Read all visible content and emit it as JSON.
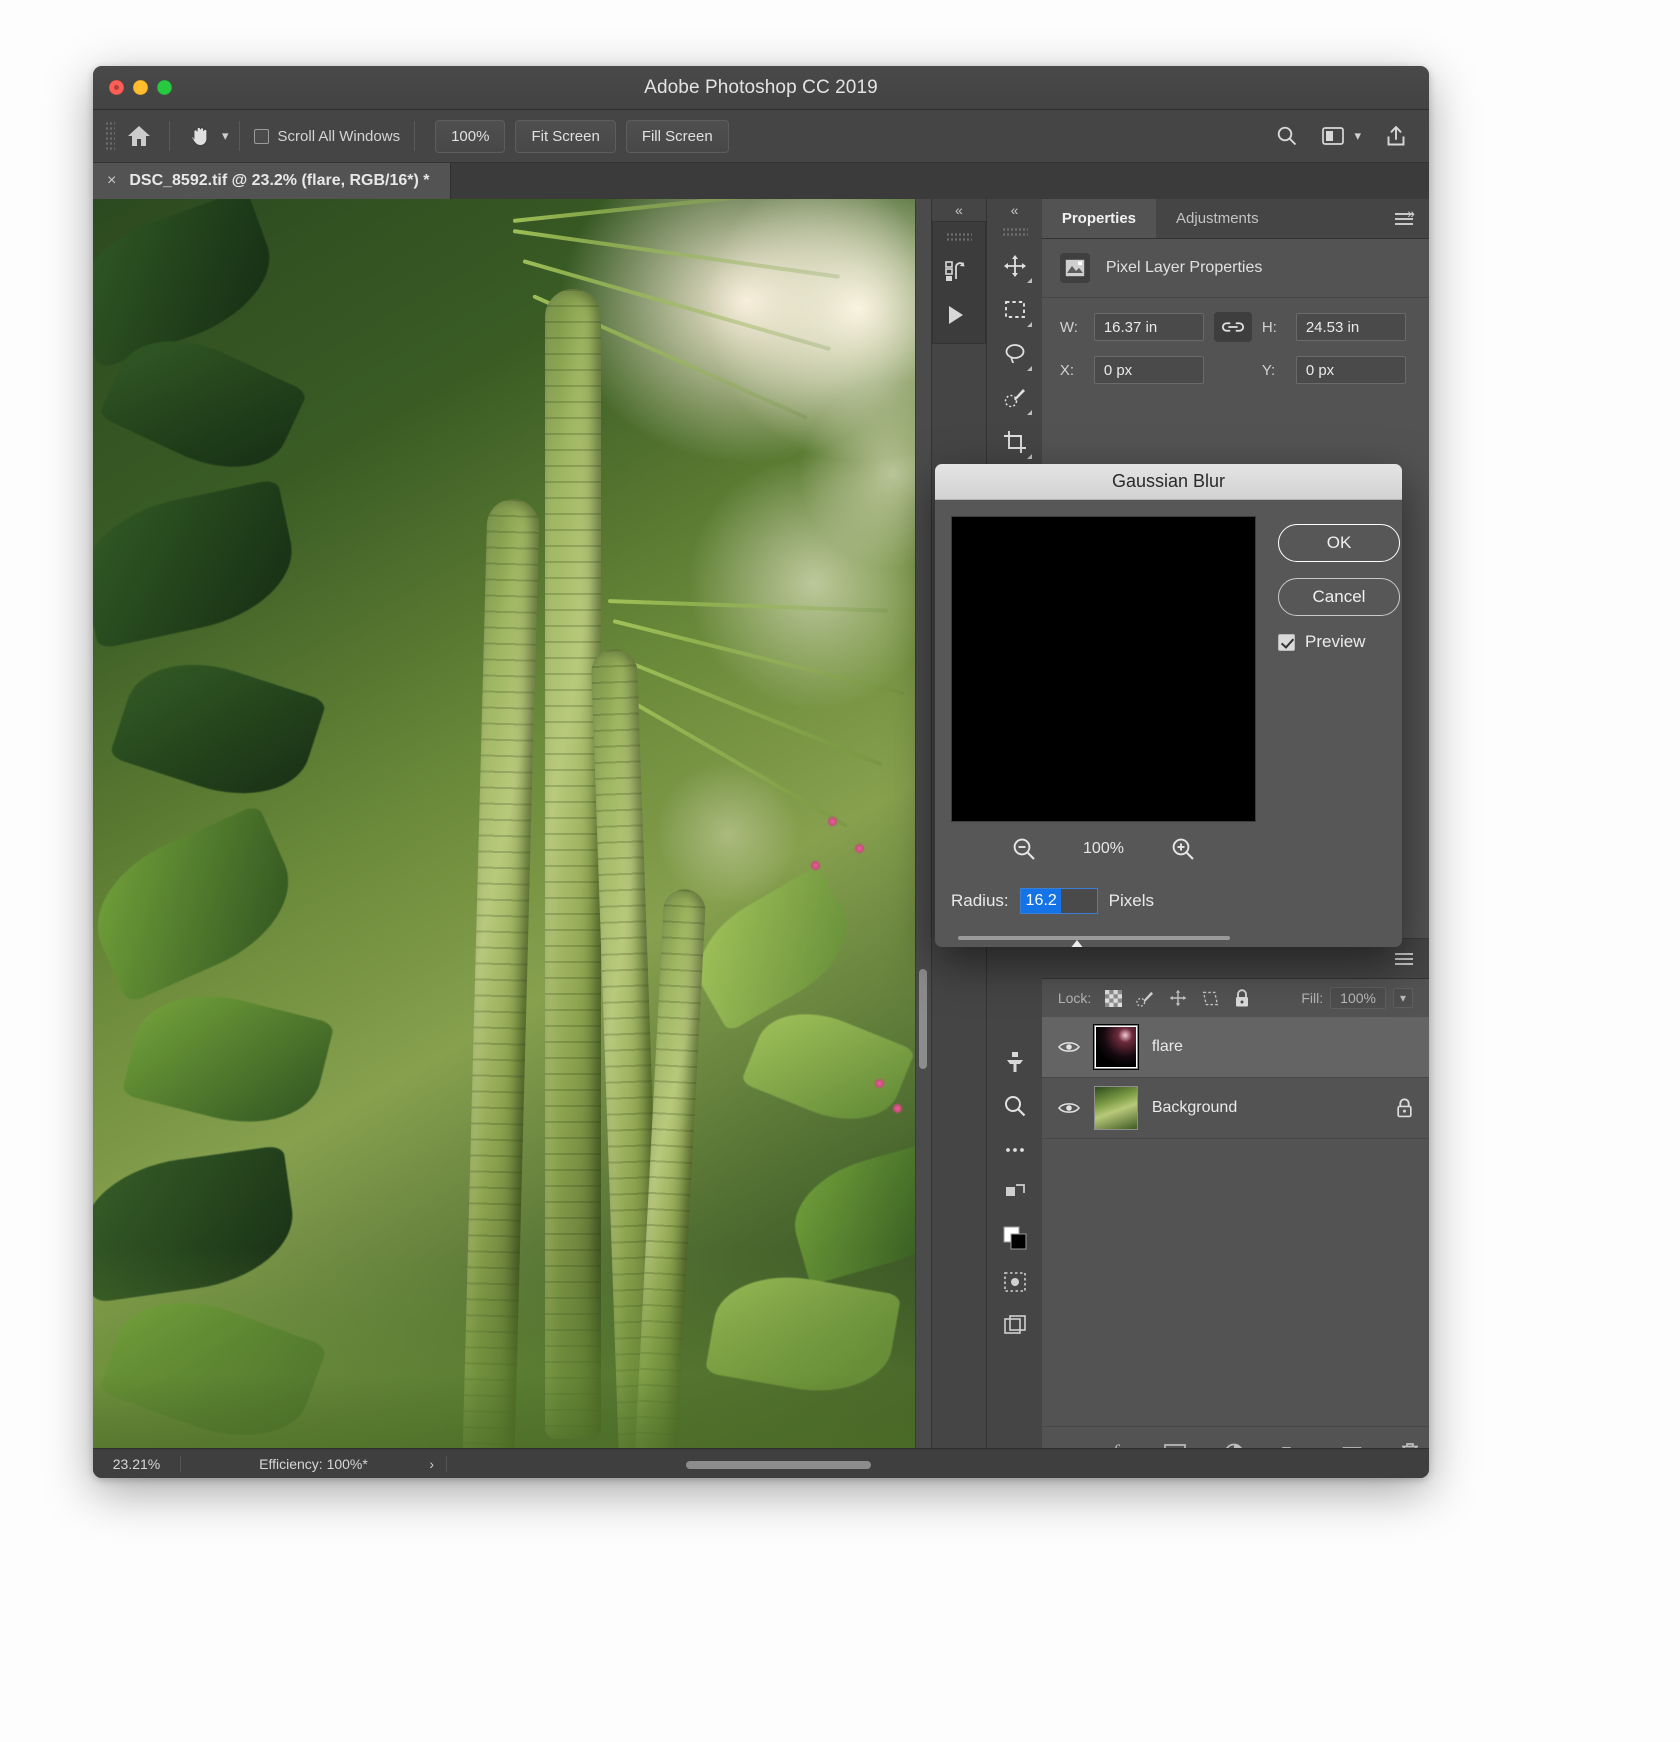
{
  "window": {
    "title": "Adobe Photoshop CC 2019",
    "traffic_lights": [
      "close-button",
      "minimize-button",
      "zoom-button"
    ]
  },
  "options_bar": {
    "home_icon": "home-icon",
    "tool_icon": "hand-tool-icon",
    "tool_dropdown_icon": "chevron-down-icon",
    "scroll_all_windows": {
      "label": "Scroll All Windows",
      "checked": false
    },
    "buttons": [
      {
        "label": "100%",
        "name": "zoom-100-button"
      },
      {
        "label": "Fit Screen",
        "name": "fit-screen-button"
      },
      {
        "label": "Fill Screen",
        "name": "fill-screen-button"
      }
    ],
    "right_icons": [
      "search-icon",
      "workspace-icon",
      "chevron-down-icon",
      "share-icon"
    ]
  },
  "document_tab": {
    "close_glyph": "×",
    "title": "DSC_8592.tif @ 23.2% (flare, RGB/16*) *"
  },
  "tool_dock": {
    "collapse_glyph": "«",
    "tools": [
      "move-tool-icon",
      "rectangular-marquee-tool-icon",
      "lasso-tool-icon",
      "brush-tool-icon",
      "crop-tool-icon",
      "frame-tool-icon",
      "eyedropper-tool-icon",
      "clone-stamp-tool-icon",
      "zoom-tool-icon",
      "more-tools-icon"
    ],
    "secondary": [
      "history-icon",
      "play-icon"
    ]
  },
  "properties_panel": {
    "tabs": [
      {
        "label": "Properties",
        "active": true
      },
      {
        "label": "Adjustments",
        "active": false
      }
    ],
    "menu_icon": "panel-menu-icon",
    "header": {
      "icon": "pixel-layer-icon",
      "title": "Pixel Layer Properties"
    },
    "fields": [
      {
        "label": "W:",
        "value": "16.37 in",
        "name": "width-field"
      },
      {
        "label": "H:",
        "value": "24.53 in",
        "name": "height-field"
      },
      {
        "label": "X:",
        "value": "0 px",
        "name": "x-position-field"
      },
      {
        "label": "Y:",
        "value": "0 px",
        "name": "y-position-field"
      }
    ],
    "link_icon": "link-aspect-ratio-icon"
  },
  "layers_panel": {
    "lock_label": "Lock:",
    "lock_icons": [
      "lock-transparent-pixels-icon",
      "lock-image-pixels-icon",
      "lock-position-icon",
      "lock-artboard-icon",
      "lock-all-icon"
    ],
    "fill": {
      "label": "Fill:",
      "value": "100%"
    },
    "layers": [
      {
        "name": "flare",
        "visible": true,
        "selected": true,
        "locked": false,
        "thumbnail": "flare-thumbnail"
      },
      {
        "name": "Background",
        "visible": true,
        "selected": false,
        "locked": true,
        "thumbnail": "background-thumbnail"
      }
    ],
    "footer_icons": [
      "link-layers-icon",
      "layer-style-fx-icon",
      "add-layer-mask-icon",
      "new-adjustment-layer-icon",
      "new-group-icon",
      "new-layer-icon",
      "delete-layer-icon"
    ]
  },
  "gaussian_blur_dialog": {
    "title": "Gaussian Blur",
    "ok_label": "OK",
    "cancel_label": "Cancel",
    "preview": {
      "label": "Preview",
      "checked": true
    },
    "zoom": {
      "out_icon": "zoom-out-icon",
      "level": "100%",
      "in_icon": "zoom-in-icon"
    },
    "radius": {
      "label": "Radius:",
      "value": "16.2",
      "unit": "Pixels",
      "slider_position_percent": 40
    },
    "accent_color": "#1473e6"
  },
  "status_bar": {
    "zoom": "23.21%",
    "efficiency": "Efficiency: 100%*",
    "expand_glyph": "›"
  }
}
